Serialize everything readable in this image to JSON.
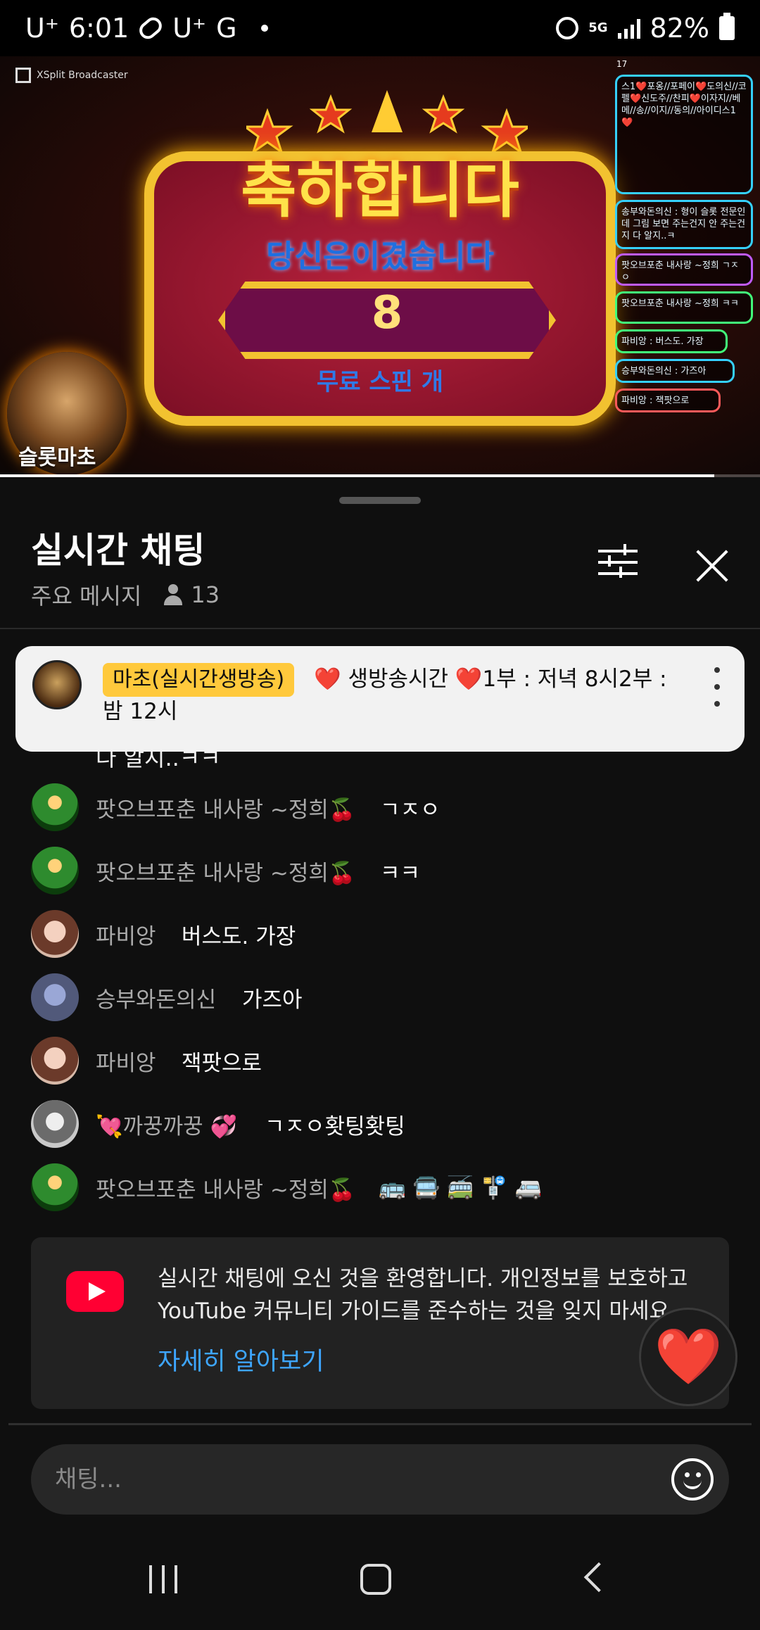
{
  "status_bar": {
    "carrier1": "U⁺",
    "time": "6:01",
    "carrier2": "U⁺",
    "network_letter": "G",
    "net_5g": "5G",
    "battery_percent": "82%"
  },
  "video": {
    "broadcaster_label": "XSplit Broadcaster",
    "viewer_count_small": "17",
    "congrats_text": "축하합니다",
    "you_won_text": "당신은이겼습니다",
    "spin_count": "8",
    "free_spin_text": "무료 스핀 개",
    "streamer_name": "슬롯마초",
    "progress_fraction": 0.94,
    "overlay_messages": [
      "스1❤️포옹//포페이❤️도의신//코펠❤️신도주//찬피❤️이자지//베메//송//이지//동의//아이디스1❤️",
      "송부와돈의신 : 형이 슬롯 전문인데 그림 보면 주는건지 안 주는건지 다 알지..ㅋ",
      "팟오브포춘 내사랑 ~정희 ㄱㅈㅇ",
      "팟오브포춘 내사랑 ~정희 ㅋㅋ",
      "파비앙 : 버스도. 가장",
      "승부와돈의신 : 가즈아",
      "파비앙 : 잭팟으로"
    ]
  },
  "chat": {
    "title": "실시간 채팅",
    "mode_label": "주요 메시지",
    "viewer_count": "13",
    "pinned": {
      "author_badge": "마초(실시간생방송)",
      "message": "❤️ 생방송시간 ❤️1부 : 저녁 8시2부 : 밤 12시"
    },
    "partial_message": "다 알지..ㅋㅋ",
    "messages": [
      {
        "author": "팟오브포춘 내사랑 ~정희🍒",
        "text": "ㄱㅈㅇ"
      },
      {
        "author": "팟오브포춘 내사랑 ~정희🍒",
        "text": "ㅋㅋ"
      },
      {
        "author": "파비앙",
        "text": "버스도. 가장"
      },
      {
        "author": "승부와돈의신",
        "text": "가즈아"
      },
      {
        "author": "파비앙",
        "text": "잭팟으로"
      },
      {
        "author": "💘까꿍까꿍 💞",
        "text": "ㄱㅈㅇ홧팅홧팅"
      },
      {
        "author": "팟오브포춘 내사랑 ~정희🍒",
        "text": "🚌 🚍 🚎 🚏 🚐"
      }
    ],
    "welcome": {
      "text": "실시간 채팅에 오신 것을 환영합니다. 개인정보를 보호하고 YouTube 커뮤니티 가이드를 준수하는 것을 잊지 마세요.",
      "learn_more": "자세히 알아보기"
    },
    "input_placeholder": "채팅...",
    "heart_emoji": "❤️"
  },
  "colors": {
    "badge": "#ffc93c",
    "link": "#3ea6ff",
    "youtube_red": "#ff0033"
  }
}
